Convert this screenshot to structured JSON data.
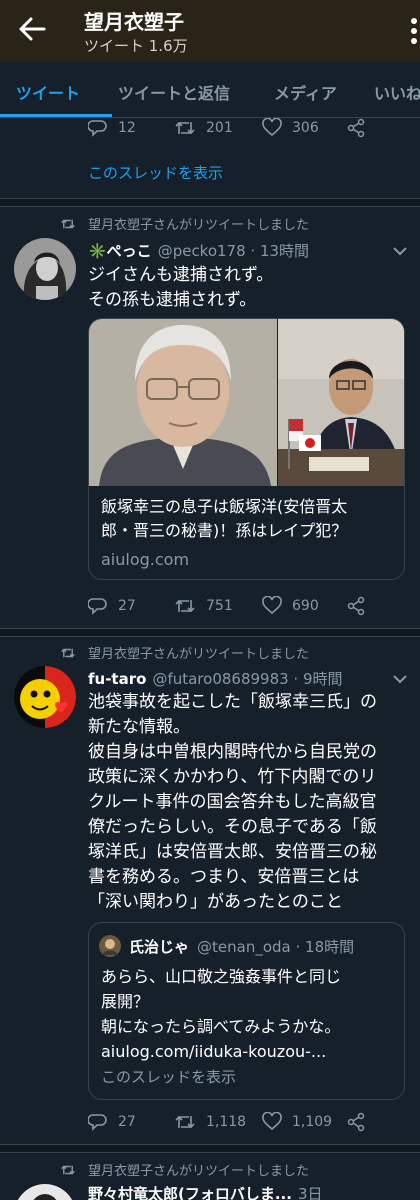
{
  "header": {
    "name": "望月衣塑子",
    "tweet_count": "ツイート 1.6万"
  },
  "tabs": [
    {
      "label": "ツイート",
      "active": true
    },
    {
      "label": "ツイートと返信",
      "active": false
    },
    {
      "label": "メディア",
      "active": false
    },
    {
      "label": "いいね",
      "active": false
    }
  ],
  "prev_tweet": {
    "replies": "12",
    "retweets": "201",
    "likes": "306",
    "show_thread": "このスレッドを表示"
  },
  "tweet1": {
    "retweet_note": "望月衣塑子さんがリツイートしました",
    "name": "✳️ぺっこ",
    "handle": "@pecko178 · 13時間",
    "lines": [
      "ジイさんも逮捕されず。",
      "その孫も逮捕されず。"
    ],
    "card": {
      "title_lines": [
        "飯塚幸三の息子は飯塚洋(安倍晋太",
        "郎・晋三の秘書)！孫はレイプ犯？"
      ],
      "host": "aiulog.com"
    },
    "replies": "27",
    "retweets": "751",
    "likes": "690"
  },
  "tweet2": {
    "retweet_note": "望月衣塑子さんがリツイートしました",
    "name": "fu-taro",
    "handle": "@futaro08689983 · 9時間",
    "lines": [
      "池袋事故を起こした「飯塚幸三氏」の",
      "新たな情報。",
      "彼自身は中曽根内閣時代から自民党の",
      "政策に深くかかわり、竹下内閣でのリ",
      "クルート事件の国会答弁もした高級官",
      "僚だったらしい。その息子である「飯",
      "塚洋氏」は安倍晋太郎、安倍晋三の秘",
      "書を務める。つまり、安倍晋三とは",
      "「深い関わり」があったとのこと"
    ],
    "quote": {
      "name": "氏治じゃ",
      "handle": "@tenan_oda · 18時間",
      "lines": [
        "あらら、山口敬之強姦事件と同じ",
        "展開？",
        "朝になったら調べてみようかな。",
        "aiulog.com/iiduka-kouzou-..."
      ],
      "show_thread": "このスレッドを表示"
    },
    "replies": "27",
    "retweets": "1,118",
    "likes": "1,109"
  },
  "tweet3": {
    "retweet_note": "望月衣塑子さんがリツイートしました",
    "name": "野々村竜太郎(フォロバしま...",
    "handle": "3日"
  },
  "colors": {
    "accent": "#1da1f2",
    "background": "#15202b",
    "header_bg": "#2a2418",
    "muted": "#8899a6",
    "divider": "#38444d"
  },
  "icons": [
    "back-arrow-icon",
    "more-vertical-icon",
    "reply-icon",
    "retweet-icon",
    "like-icon",
    "share-icon",
    "caret-down-icon"
  ]
}
